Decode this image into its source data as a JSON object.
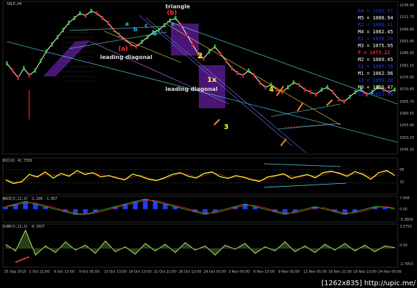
{
  "chart_data": {
    "type": "line",
    "symbol": "GOLD,H4",
    "price_axis": [
      "1106.90",
      "1101.75",
      "1096.60",
      "1091.45",
      "1086.30",
      "1081.15",
      "1076.00",
      "1070.85",
      "1065.70",
      "1060.55",
      "1055.40",
      "1050.25",
      "1045.10"
    ],
    "time_axis": [
      "25 Sep 2015",
      "1 Oct 21:00",
      "6 Oct 13:00",
      "9 Oct 05:00",
      "13 Oct 13:00",
      "16 Oct 13:00",
      "21 Oct 21:00",
      "26 Oct 13:00",
      "29 Oct 05:00",
      "3 Nov 05:00",
      "6 Nov 13:00",
      "9 Nov 05:00",
      "12 Nov 05:00",
      "16 Nov 21:00",
      "19 Nov 13:00",
      "24 Nov 05:00"
    ],
    "pivot_levels": [
      {
        "label": "R4",
        "value": "1101.97",
        "color": "#1e3cff"
      },
      {
        "label": "M5",
        "value": "1088.94",
        "color": "#ffffff"
      },
      {
        "label": "R2",
        "value": "1086.21",
        "color": "#1e3cff"
      },
      {
        "label": "M4",
        "value": "1082.45",
        "color": "#ffffff"
      },
      {
        "label": "R1",
        "value": "1078.70",
        "color": "#1e3cff"
      },
      {
        "label": "M3",
        "value": "1075.95",
        "color": "#ffffff"
      },
      {
        "label": "P",
        "value": "1073.22",
        "color": "#ff2020"
      },
      {
        "label": "M2",
        "value": "1069.45",
        "color": "#ffffff"
      },
      {
        "label": "S1",
        "value": "1065.70",
        "color": "#1e3cff"
      },
      {
        "label": "M1",
        "value": "1062.96",
        "color": "#ffffff"
      },
      {
        "label": "S2",
        "value": "1059.20",
        "color": "#1e3cff"
      },
      {
        "label": "M0",
        "value": "1056.47",
        "color": "#ffffff"
      },
      {
        "label": "S3",
        "value": "1052.70",
        "color": "#1e3cff"
      }
    ],
    "price_series": [
      1082,
      1079,
      1076,
      1080,
      1077,
      1079,
      1083,
      1087,
      1090,
      1093,
      1096,
      1099,
      1101,
      1103,
      1102,
      1104,
      1103,
      1101,
      1099,
      1096,
      1094,
      1092,
      1090,
      1089,
      1091,
      1093,
      1095,
      1096,
      1098,
      1100,
      1101,
      1098,
      1094,
      1090,
      1086,
      1084,
      1087,
      1089,
      1086,
      1083,
      1080,
      1078,
      1077,
      1079,
      1077,
      1074,
      1072,
      1073,
      1071,
      1070,
      1072,
      1074,
      1073,
      1071,
      1070,
      1069,
      1071,
      1072,
      1070,
      1067,
      1066,
      1068,
      1070,
      1071,
      1069,
      1070,
      1072,
      1071,
      1070,
      1071
    ],
    "wave_labels": [
      {
        "text": "triangle",
        "color": "#dddddd"
      },
      {
        "text": "(b)",
        "color": "#ff3030"
      },
      {
        "text": "(a)",
        "color": "#ff3030"
      },
      {
        "text": "leading diagonal",
        "color": "#dddddd"
      },
      {
        "text": "leading diagonal",
        "color": "#dddddd"
      },
      {
        "text": "2",
        "color": "#ffff20"
      },
      {
        "text": "1x",
        "color": "#ffff20"
      },
      {
        "text": "3",
        "color": "#ffff20"
      },
      {
        "text": "4",
        "color": "#ffff20"
      },
      {
        "text": "a",
        "color": "#20c0ff"
      },
      {
        "text": "b",
        "color": "#20c0ff"
      },
      {
        "text": "c",
        "color": "#20c0ff"
      },
      {
        "text": "d",
        "color": "#20c0ff"
      },
      {
        "text": "e",
        "color": "#20c0ff"
      }
    ],
    "rsi": {
      "label": "RSI(8) 41.7559",
      "levels": [
        "68",
        "32"
      ],
      "series": [
        40,
        30,
        35,
        55,
        48,
        62,
        45,
        58,
        50,
        66,
        55,
        60,
        48,
        52,
        45,
        40,
        56,
        50,
        42,
        38,
        46,
        55,
        60,
        50,
        45,
        58,
        62,
        49,
        44,
        52,
        47,
        40,
        36,
        48,
        52,
        57,
        44,
        50,
        55,
        46,
        60,
        64,
        58,
        50,
        63,
        55,
        42,
        60,
        66,
        52
      ]
    },
    "macd": {
      "label": "MACD(5,12,3) -1.109 -1.057",
      "axis": [
        "7.408",
        "0.00",
        "-5.3856"
      ],
      "series": [
        1,
        2,
        3,
        2,
        1,
        0,
        -1,
        -2,
        -2,
        -1,
        0,
        1,
        2,
        3,
        4,
        3,
        2,
        1,
        0,
        -1,
        -2,
        -1,
        0,
        1,
        2,
        1,
        0,
        -1,
        -2,
        -1,
        0,
        1,
        0,
        -1,
        -2,
        -1,
        0,
        1,
        1,
        0
      ]
    },
    "osma": {
      "label": "OsMA(5,12,3) -0.1027",
      "axis": [
        "3.2755",
        "0.00",
        "-2.7953"
      ],
      "series": [
        0.5,
        -0.3,
        2.2,
        -0.8,
        0.3,
        -0.5,
        0.8,
        -0.2,
        0.4,
        -0.6,
        0.9,
        -0.4,
        0.2,
        -0.7,
        0.6,
        -0.3,
        0.5,
        -0.5,
        0.7,
        -0.2,
        0.3,
        -0.8,
        0.4,
        -0.1,
        0.6,
        -0.6,
        0.2,
        -0.3,
        0.8,
        -0.4,
        0.3,
        -0.5,
        0.5,
        -0.2,
        0.6,
        -0.3,
        0.4,
        -0.4,
        0.3,
        0.1
      ]
    }
  },
  "watermark": "[1262x835] http://upic.me/"
}
